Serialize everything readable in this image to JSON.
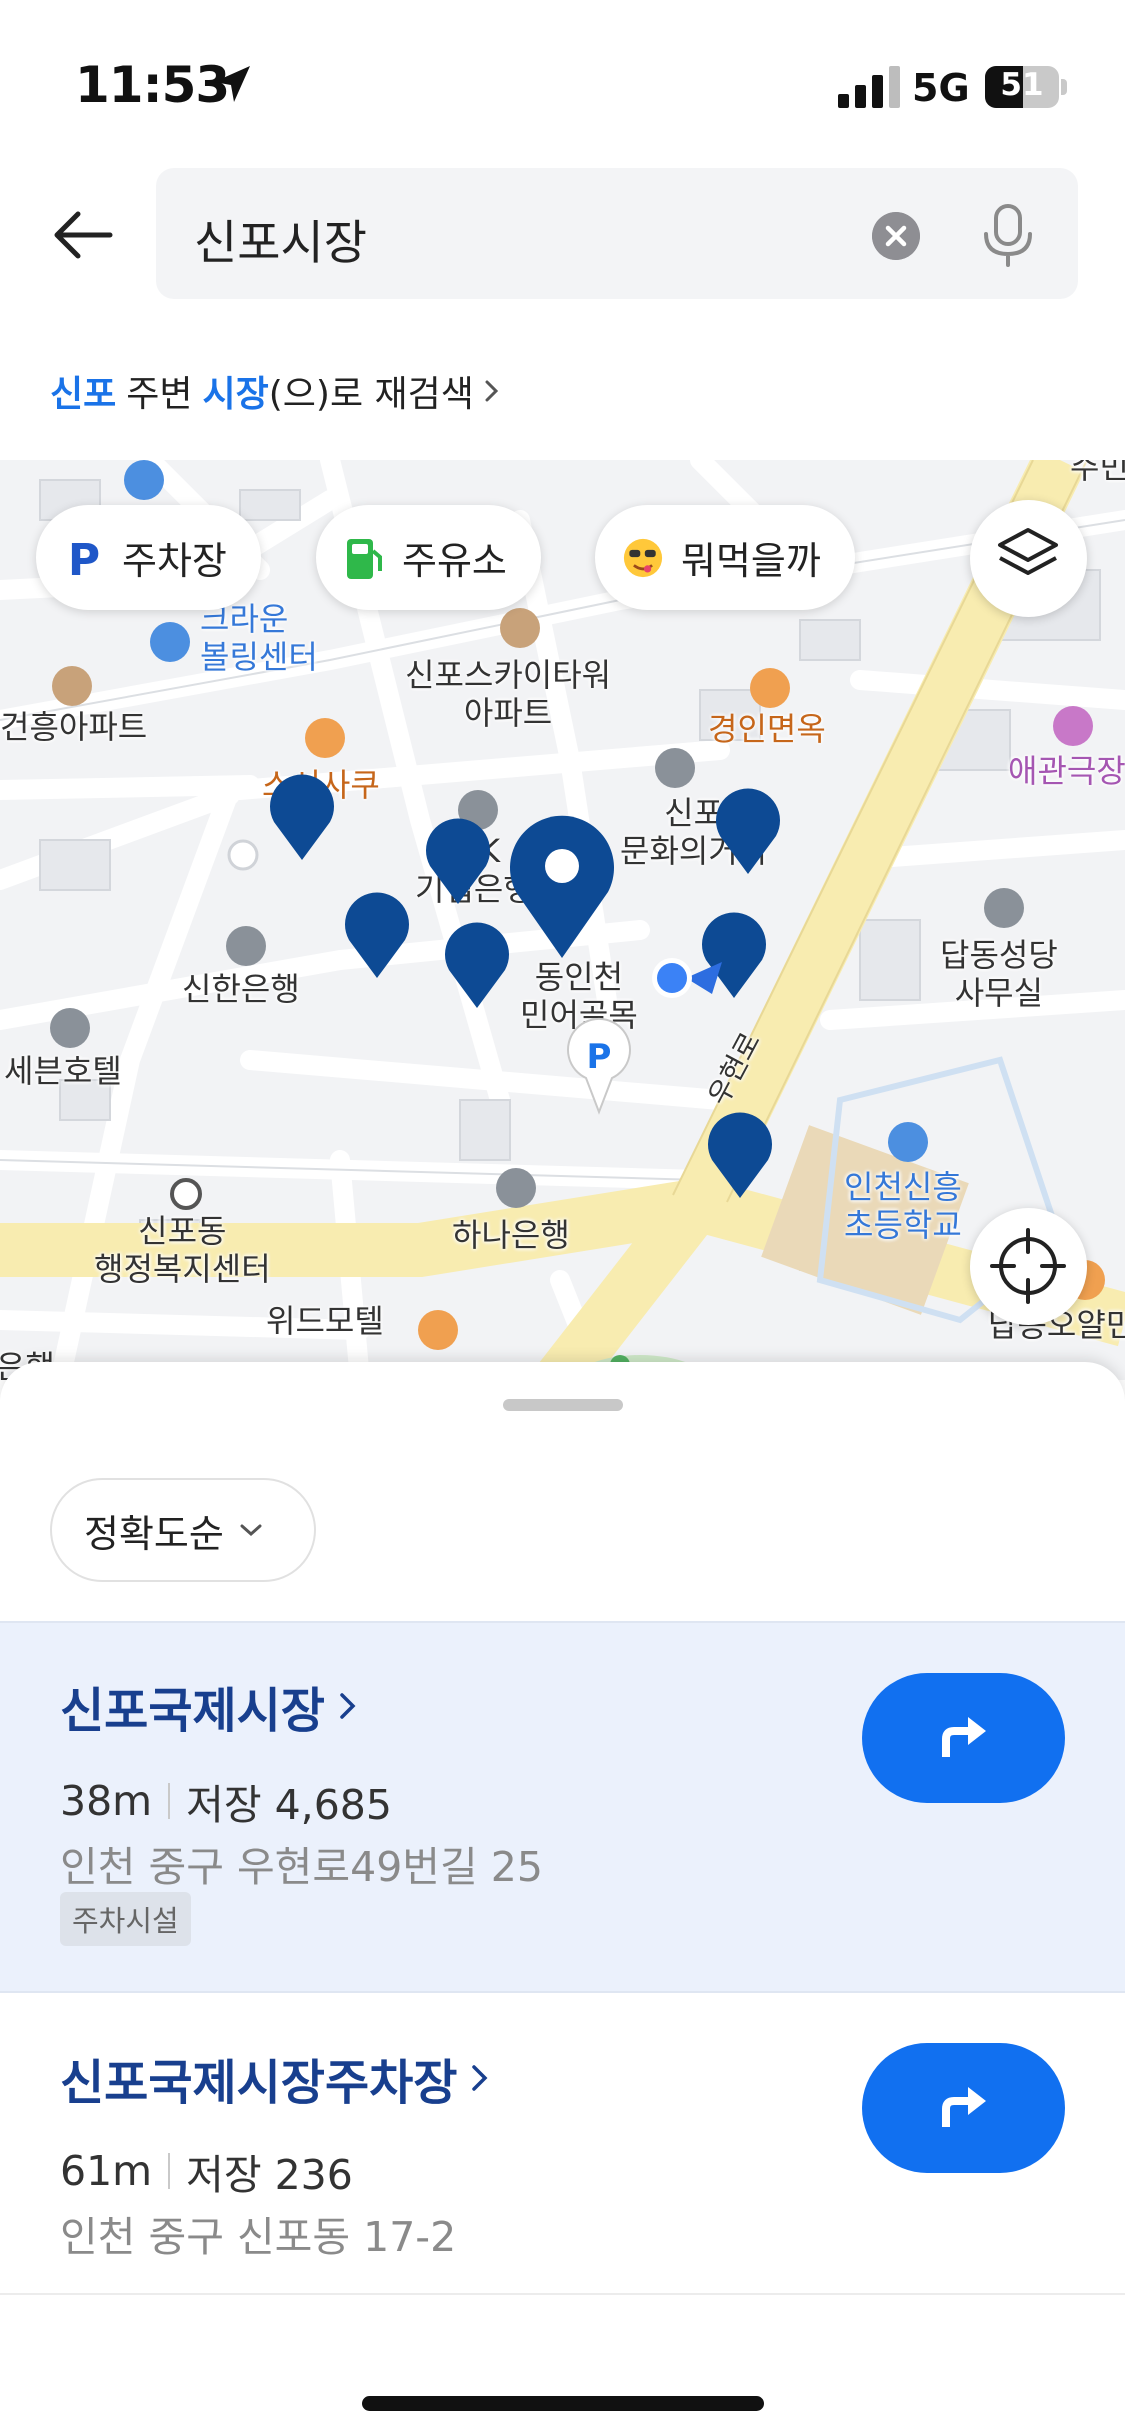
{
  "status_bar": {
    "time": "11:53",
    "network": "5G",
    "battery": "51",
    "battery_level": 0.51
  },
  "search": {
    "query": "신포시장"
  },
  "research": {
    "word1": "신포",
    "text1": "주변",
    "word2": "시장",
    "text2": "(으)로 재검색"
  },
  "filters": [
    {
      "label": "주차장",
      "icon": "parking-icon"
    },
    {
      "label": "주유소",
      "icon": "gas-station-icon"
    },
    {
      "label": "뭐먹을까",
      "icon": "sunglasses-emoji-icon"
    }
  ],
  "map_labels": {
    "crown_bowling": "크라운\n볼링센터",
    "sky_tower": "신포스카이타워\n아파트",
    "gyeongin": "경인면옥",
    "aegwan": "애관극장",
    "apt_left": "건흥아파트",
    "sushi": "스시사쿠",
    "sinpo_culture": "신포\n문화의거리",
    "ibk": "IBK\n기업은행",
    "dongincheon": "동인천\n민어골목",
    "shinhan": "신한은행",
    "dapdong": "답동성당\n사무실",
    "seven_hotel": "세븐호텔",
    "road": "우현로",
    "incheon_school": "인천신흥\n초등학교",
    "sinpodong": "신포동\n행정복지센터",
    "hana": "하나은행",
    "wid_motel": "위드모텔",
    "dapdong_right": "답동오얄민",
    "edge_top": "주민",
    "edge_bottom": "은행"
  },
  "sort": {
    "label": "정확도순"
  },
  "results": [
    {
      "name": "신포국제시장",
      "distance": "38m",
      "saves": "저장 4,685",
      "address": "인천 중구 우현로49번길 25",
      "tag": "주차시설"
    },
    {
      "name": "신포국제시장주차장",
      "distance": "61m",
      "saves": "저장 236",
      "address": "인천 중구 신포동 17-2"
    }
  ],
  "colors": {
    "accent": "#1170f0",
    "title": "#183f8e",
    "marker": "#0d4a94",
    "highlight": "#1a73e8"
  }
}
